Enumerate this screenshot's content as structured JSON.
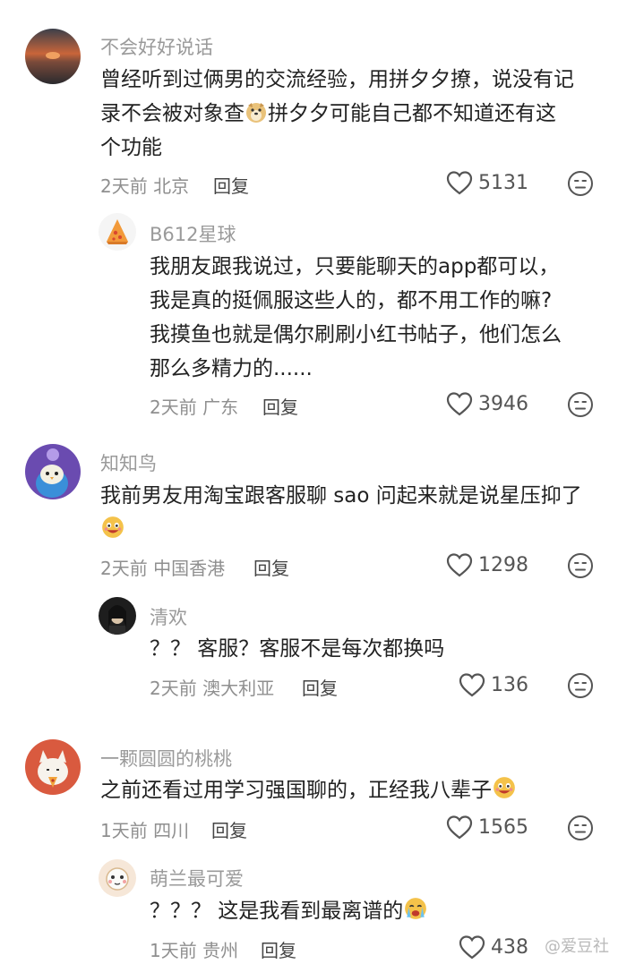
{
  "comments": [
    {
      "username": "不会好好说话",
      "lines": [
        "曾经听到过俩男的交流经验，用拼夕夕撩，说没有记",
        "录不会被对象查",
        "拼夕夕可能自己都不知道还有这",
        "个功能"
      ],
      "time": "2天前",
      "location": "北京",
      "reply_label": "回复",
      "likes": "5131"
    },
    {
      "username": "B612星球",
      "lines": [
        "我朋友跟我说过，只要能聊天的app都可以，",
        "我是真的挺佩服这些人的，都不用工作的嘛?",
        "我摸鱼也就是偶尔刷刷小红书帖子，他们怎么",
        "那么多精力的......"
      ],
      "time": "2天前",
      "location": "广东",
      "reply_label": "回复",
      "likes": "3946"
    },
    {
      "username": "知知鸟",
      "lines": [
        "我前男友用淘宝跟客服聊 sao 问起来就是说星压抑了"
      ],
      "time": "2天前",
      "location": "中国香港",
      "reply_label": "回复",
      "likes": "1298"
    },
    {
      "username": "清欢",
      "lines": [
        "？？ 客服？客服不是每次都换吗"
      ],
      "time": "2天前",
      "location": "澳大利亚",
      "reply_label": "回复",
      "likes": "136"
    },
    {
      "username": "一颗圆圆的桃桃",
      "lines": [
        "之前还看过用学习强国聊的，正经我八辈子"
      ],
      "time": "1天前",
      "location": "四川",
      "reply_label": "回复",
      "likes": "1565"
    },
    {
      "username": "萌兰最可爱",
      "lines": [
        "？？？ 这是我看到最离谱的"
      ],
      "time": "1天前",
      "location": "贵州",
      "reply_label": "回复",
      "likes": "438"
    }
  ],
  "watermark": "@爱豆社",
  "colors": {
    "text": "#222222",
    "meta": "#8f8f8f",
    "icon": "#555555"
  }
}
